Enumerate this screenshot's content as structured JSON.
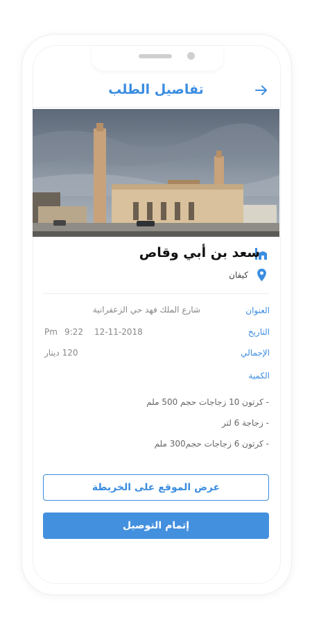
{
  "header": {
    "title": "تفاصيل الطلب",
    "back_icon": "arrow-right-icon"
  },
  "colors": {
    "accent": "#3b8de0",
    "button": "#4390df"
  },
  "place": {
    "name": "سعد بن أبي وقاص",
    "icon": "mosque-icon",
    "city": "كيفان",
    "city_icon": "map-pin-icon"
  },
  "details": {
    "address_label": "العنوان",
    "address_value": "شارع الملك فهد حي الزعفرانية",
    "date_label": "التاريخ",
    "date_value": "12-11-2018",
    "time_value": "9:22",
    "time_period": "Pm",
    "total_label": "الإجمالي",
    "total_value": "120 دينار",
    "quantity_label": "الكمية"
  },
  "items": [
    "- كرتون 10 زجاجات حجم 500 ملم",
    "- زجاجة 6 لتر",
    "- كرتون 6 زجاجات حجم300 ملم"
  ],
  "buttons": {
    "map": "عرض الموقع على الخريطة",
    "complete": "إتمام التوصيل"
  }
}
